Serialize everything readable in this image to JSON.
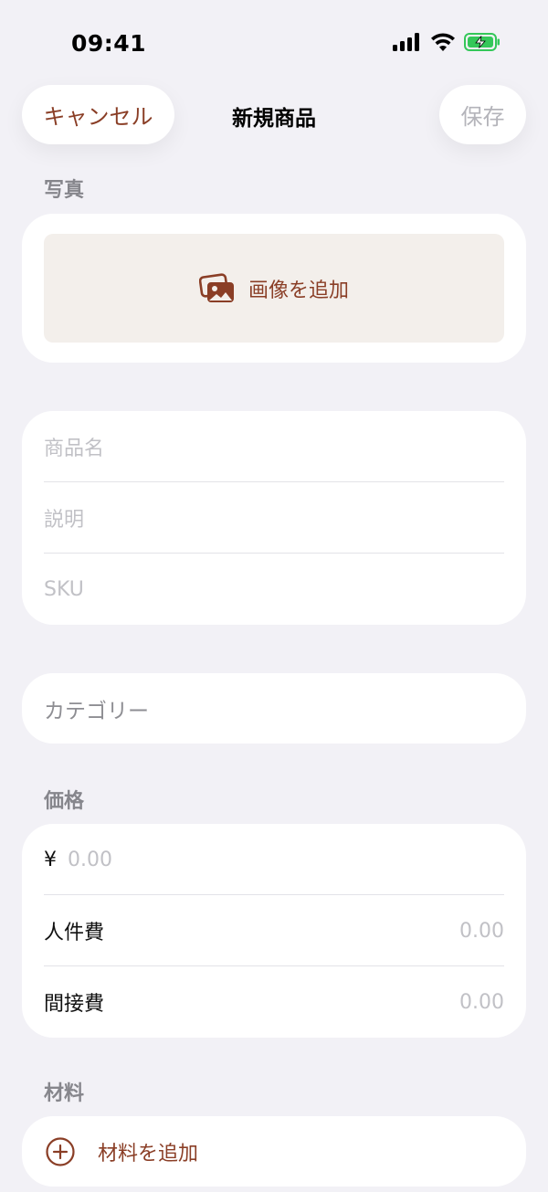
{
  "status_bar": {
    "time": "09:41",
    "battery_color": "#34C759"
  },
  "nav": {
    "cancel_label": "キャンセル",
    "title": "新規商品",
    "save_label": "保存"
  },
  "photo_section": {
    "label": "写真",
    "add_image_label": "画像を追加",
    "icon": "photo-stack-icon"
  },
  "details": {
    "name_placeholder": "商品名",
    "description_placeholder": "説明",
    "sku_placeholder": "SKU"
  },
  "category": {
    "label": "カテゴリー"
  },
  "price_section": {
    "label": "価格",
    "currency_symbol": "¥",
    "price_placeholder": "0.00",
    "labor_label": "人件費",
    "labor_value": "0.00",
    "overhead_label": "間接費",
    "overhead_value": "0.00"
  },
  "materials_section": {
    "label": "材料",
    "add_material_label": "材料を追加",
    "icon": "plus-circle-icon"
  },
  "colors": {
    "accent": "#8A3E26",
    "background": "#F2F1F6",
    "placeholder": "#C1C1C6"
  }
}
